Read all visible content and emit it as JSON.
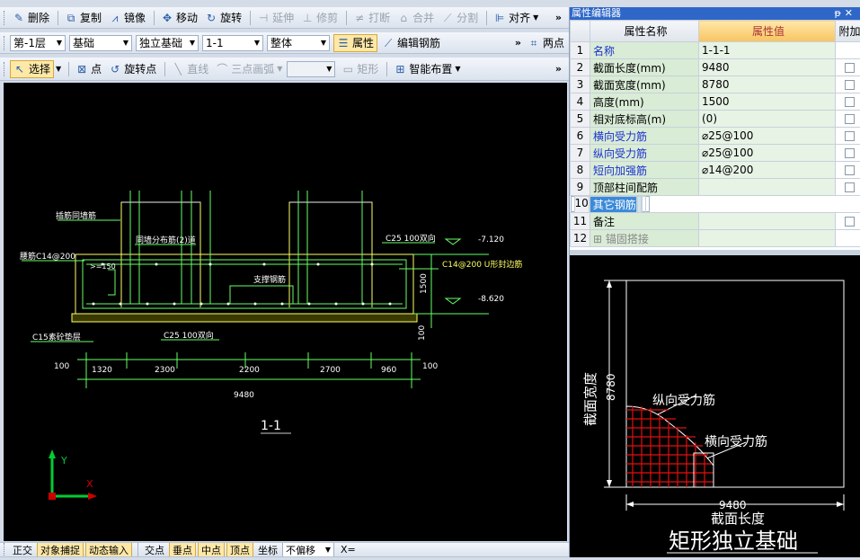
{
  "toolbar1": {
    "items": [
      "删除",
      "复制",
      "镜像",
      "移动",
      "旋转",
      "延伸",
      "修剪",
      "打断",
      "合并",
      "分割",
      "对齐"
    ]
  },
  "toolbar2": {
    "floor": "第-1层",
    "category": "基础",
    "type": "独立基础",
    "name": "1-1",
    "scope": "整体",
    "property": "属性",
    "edit_rebar": "编辑钢筋",
    "two_point": "两点"
  },
  "toolbar3": {
    "select": "选择",
    "point": "点",
    "rotate_point": "旋转点",
    "line": "直线",
    "arc": "三点画弧",
    "rect": "矩形",
    "smart": "智能布置"
  },
  "status": {
    "items": [
      "正交",
      "对象捕捉",
      "动态输入",
      "交点",
      "垂点",
      "中点",
      "顶点",
      "坐标",
      "不偏移",
      "X="
    ]
  },
  "drawing": {
    "labels": {
      "insert_rebar": "插筋同墙筋",
      "wall_dist": "同墙分布筋(2)道",
      "side_rebar": "腰筋C14@200",
      "ge150": ">=150",
      "support": "支撑钢筋",
      "c25_top": "C25 100双向",
      "c25_bot": "C25 100双向",
      "u_rebar": "C14@200 U形封边筋",
      "c15": "C15素砼垫层",
      "elev_top": "-7.120",
      "elev_bot": "-8.620",
      "h1500": "1500",
      "h100": "100",
      "section": "1-1"
    },
    "dims": [
      "100",
      "1320",
      "2300",
      "2200",
      "2700",
      "960",
      "100"
    ],
    "total": "9480"
  },
  "panel": {
    "title": "属性编辑器",
    "headers": {
      "name": "属性名称",
      "value": "属性值",
      "extra": "附加"
    },
    "rows": [
      {
        "n": "1",
        "name": "名称",
        "value": "1-1-1",
        "style": "blue",
        "cb": false
      },
      {
        "n": "2",
        "name": "截面长度(mm)",
        "value": "9480",
        "style": "",
        "cb": true
      },
      {
        "n": "3",
        "name": "截面宽度(mm)",
        "value": "8780",
        "style": "",
        "cb": true
      },
      {
        "n": "4",
        "name": "高度(mm)",
        "value": "1500",
        "style": "",
        "cb": true
      },
      {
        "n": "5",
        "name": "相对底标高(m)",
        "value": "(0)",
        "style": "",
        "cb": true
      },
      {
        "n": "6",
        "name": "横向受力筋",
        "value": "⌀25@100",
        "style": "blue",
        "cb": true
      },
      {
        "n": "7",
        "name": "纵向受力筋",
        "value": "⌀25@100",
        "style": "blue",
        "cb": true
      },
      {
        "n": "8",
        "name": "短向加强筋",
        "value": "⌀14@200",
        "style": "blue",
        "cb": true
      },
      {
        "n": "9",
        "name": "顶部柱间配筋",
        "value": "",
        "style": "",
        "cb": true
      },
      {
        "n": "10",
        "name": "其它钢筋",
        "value": "",
        "style": "sel",
        "cb": false
      },
      {
        "n": "11",
        "name": "备注",
        "value": "",
        "style": "",
        "cb": true
      },
      {
        "n": "12",
        "name": "锚固搭接",
        "value": "",
        "style": "gray",
        "cb": false
      }
    ]
  },
  "preview": {
    "width_label": "截面宽度",
    "width": "8780",
    "length_label": "截面长度",
    "length": "9480",
    "long_rebar": "纵向受力筋",
    "cross_rebar": "横向受力筋",
    "caption": "矩形独立基础"
  }
}
